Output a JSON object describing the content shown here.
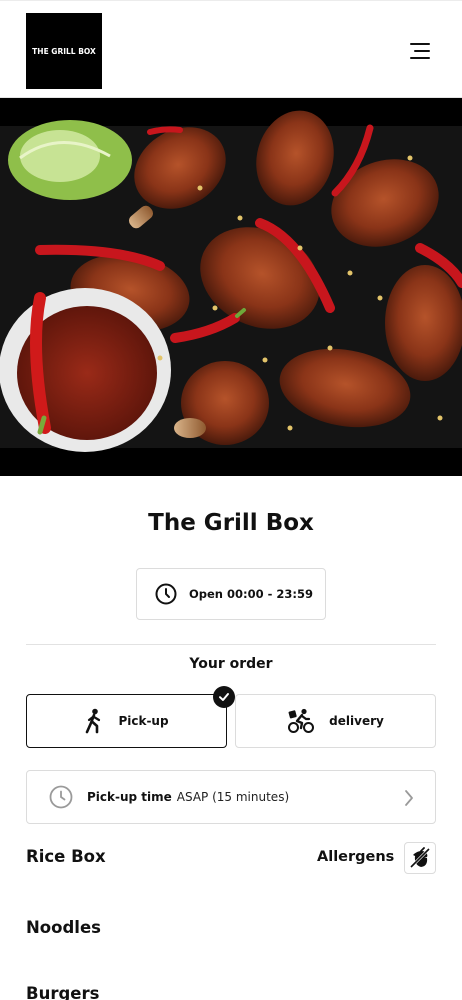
{
  "header": {
    "logo_text": "THE GRILL BOX",
    "menu_icon": "hamburger-menu-icon"
  },
  "hero": {
    "image_subject": "grilled chicken drumsticks with red chilies and dipping sauce"
  },
  "restaurant": {
    "name": "The Grill Box",
    "hours_label": "Open 00:00 - 23:59",
    "hours_icon": "clock-icon"
  },
  "order": {
    "heading": "Your order",
    "options": [
      {
        "label": "Pick-up",
        "icon": "walking-person-icon",
        "selected": true
      },
      {
        "label": "delivery",
        "icon": "bicycle-courier-icon",
        "selected": false
      }
    ],
    "time_label": "Pick-up time",
    "time_value": "ASAP (15 minutes)"
  },
  "menu": {
    "categories": [
      "Rice Box",
      "Noodles",
      "Burgers"
    ],
    "allergens_label": "Allergens",
    "allergens_icon": "nut-allergen-icon"
  },
  "colors": {
    "accent": "#111111",
    "border": "#dcdcdc",
    "chili_red": "#c8161d"
  }
}
